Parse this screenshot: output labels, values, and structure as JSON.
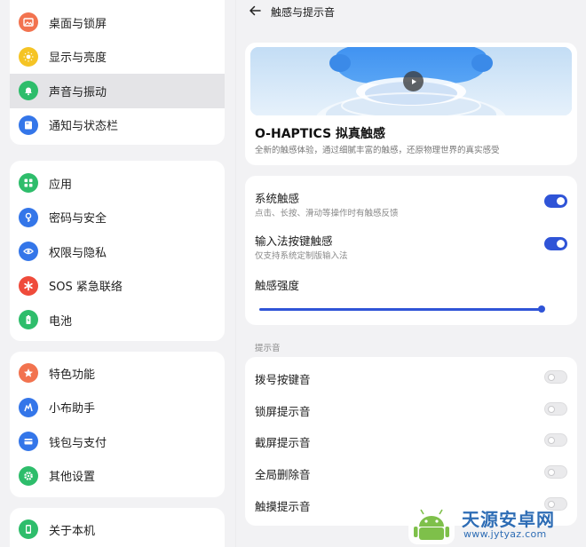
{
  "sidebar": {
    "group1": [
      {
        "label": "桌面与锁屏",
        "icon": "image-icon",
        "color": "#f2734f"
      },
      {
        "label": "显示与亮度",
        "icon": "sun-icon",
        "color": "#f5c425"
      },
      {
        "label": "声音与振动",
        "icon": "bell-icon",
        "color": "#2ebd6b",
        "active": true
      },
      {
        "label": "通知与状态栏",
        "icon": "notification-icon",
        "color": "#3476e9"
      }
    ],
    "group2": [
      {
        "label": "应用",
        "icon": "apps-icon",
        "color": "#2ebd6b"
      },
      {
        "label": "密码与安全",
        "icon": "key-icon",
        "color": "#3476e9"
      },
      {
        "label": "权限与隐私",
        "icon": "privacy-eye-icon",
        "color": "#3476e9"
      },
      {
        "label": "SOS 紧急联络",
        "icon": "sos-asterisk-icon",
        "color": "#ef4b3b"
      },
      {
        "label": "电池",
        "icon": "battery-icon",
        "color": "#2ebd6b"
      }
    ],
    "group3": [
      {
        "label": "特色功能",
        "icon": "star-icon",
        "color": "#f2734f"
      },
      {
        "label": "小布助手",
        "icon": "assistant-icon",
        "color": "#3476e9"
      },
      {
        "label": "钱包与支付",
        "icon": "wallet-icon",
        "color": "#3476e9"
      },
      {
        "label": "其他设置",
        "icon": "gear-icon",
        "color": "#2ebd6b"
      }
    ],
    "group4": [
      {
        "label": "关于本机",
        "icon": "phone-icon",
        "color": "#2ebd6b"
      }
    ]
  },
  "header": {
    "title": "触感与提示音",
    "back_icon": "back-arrow-icon"
  },
  "hero": {
    "title": "O-HAPTICS 拟真触感",
    "description": "全新的触感体验，通过细腻丰富的触感，还原物理世界的真实感受",
    "play_icon": "play-icon"
  },
  "haptics": {
    "system_haptics": {
      "title": "系统触感",
      "subtitle": "点击、长按、滑动等操作时有触感反馈",
      "on": true
    },
    "keyboard_haptics": {
      "title": "输入法按键触感",
      "subtitle": "仅支持系统定制版输入法",
      "on": true
    },
    "intensity": {
      "title": "触感强度",
      "value": 1.0
    }
  },
  "sounds": {
    "section_label": "提示音",
    "items": [
      {
        "title": "拨号按键音",
        "on": false
      },
      {
        "title": "锁屏提示音",
        "on": false
      },
      {
        "title": "截屏提示音",
        "on": false
      },
      {
        "title": "全局删除音",
        "on": false
      },
      {
        "title": "触摸提示音",
        "on": false
      }
    ]
  },
  "watermark": {
    "text": "天源安卓网",
    "url": "www.jytyaz.com"
  },
  "colors": {
    "accent": "#2f54d7",
    "background": "#f2f2f4",
    "card": "#ffffff"
  }
}
